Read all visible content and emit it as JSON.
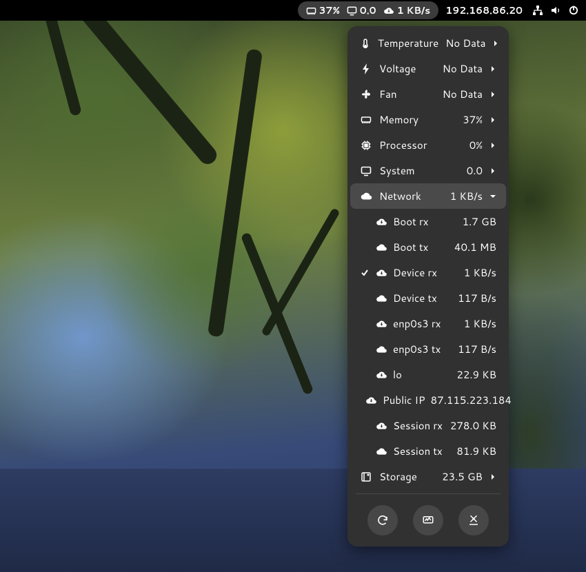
{
  "topbar": {
    "cpu_pct": "37%",
    "sys_val": "0.0",
    "net_val": "1 KB/s",
    "ip": "192.168.86.20"
  },
  "menu": {
    "rows": [
      {
        "icon": "thermometer-icon",
        "label": "Temperature",
        "value": "No Data"
      },
      {
        "icon": "bolt-icon",
        "label": "Voltage",
        "value": "No Data"
      },
      {
        "icon": "fan-icon",
        "label": "Fan",
        "value": "No Data"
      },
      {
        "icon": "memory-icon",
        "label": "Memory",
        "value": "37%"
      },
      {
        "icon": "cpu-icon",
        "label": "Processor",
        "value": "0%"
      },
      {
        "icon": "display-icon",
        "label": "System",
        "value": "0.0"
      }
    ],
    "network": {
      "label": "Network",
      "value": "1 KB/s"
    },
    "network_items": [
      {
        "checked": false,
        "icon": "cloud-down-icon",
        "label": "Boot rx",
        "value": "1.7 GB"
      },
      {
        "checked": false,
        "icon": "cloud-up-icon",
        "label": "Boot tx",
        "value": "40.1 MB"
      },
      {
        "checked": true,
        "icon": "cloud-down-icon",
        "label": "Device rx",
        "value": "1 KB/s"
      },
      {
        "checked": false,
        "icon": "cloud-up-icon",
        "label": "Device tx",
        "value": "117 B/s"
      },
      {
        "checked": false,
        "icon": "cloud-down-icon",
        "label": "enp0s3 rx",
        "value": "1 KB/s"
      },
      {
        "checked": false,
        "icon": "cloud-up-icon",
        "label": "enp0s3 tx",
        "value": "117 B/s"
      },
      {
        "checked": false,
        "icon": "cloud-down-icon",
        "label": "lo",
        "value": "22.9 KB"
      },
      {
        "checked": false,
        "icon": "cloud-down-icon",
        "label": "Public IP",
        "value": "87.115.223.184"
      },
      {
        "checked": false,
        "icon": "cloud-down-icon",
        "label": "Session rx",
        "value": "278.0 KB"
      },
      {
        "checked": false,
        "icon": "cloud-up-icon",
        "label": "Session tx",
        "value": "81.9 KB"
      }
    ],
    "storage": {
      "label": "Storage",
      "value": "23.5 GB"
    }
  }
}
